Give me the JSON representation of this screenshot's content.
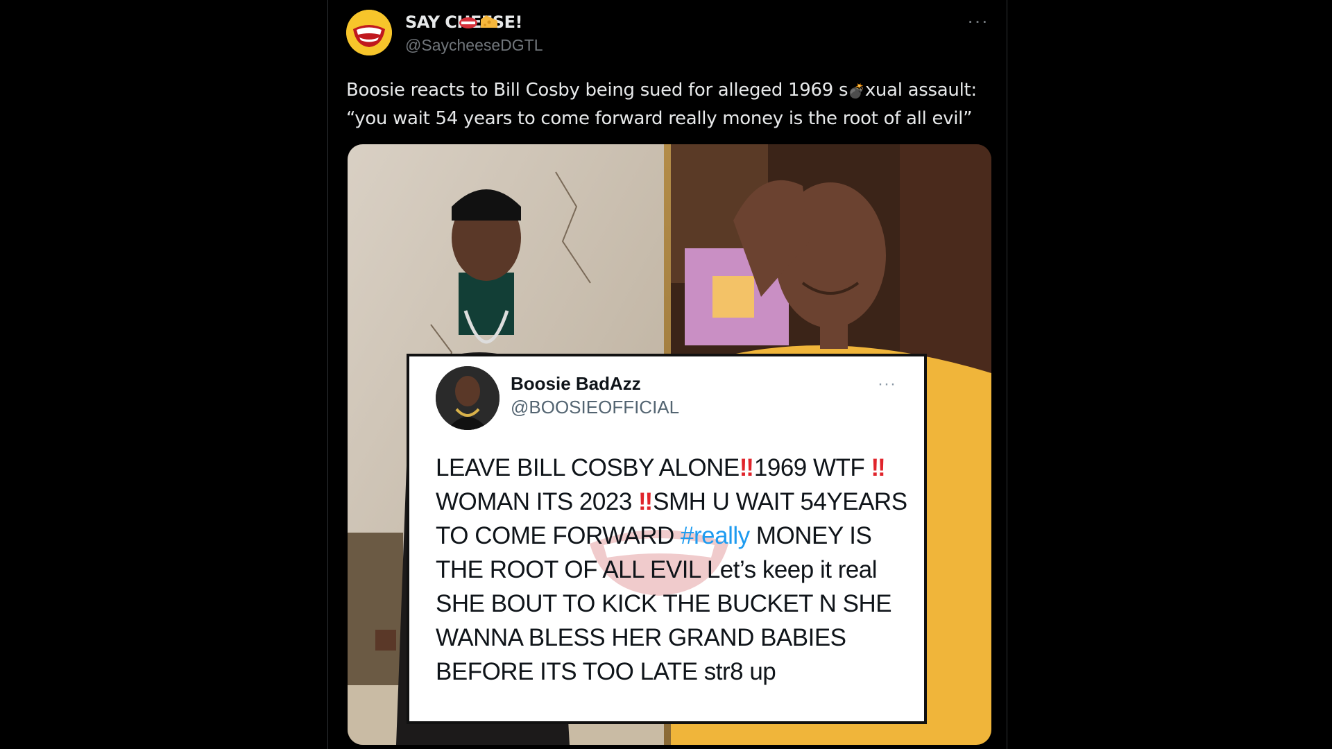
{
  "tweet": {
    "display_name": "SAY CHEESE!",
    "name_emojis": [
      "lips-icon",
      "cheese-icon"
    ],
    "handle": "@SaycheeseDGTL",
    "more_label": "···",
    "text_line1": "Boosie reacts to Bill Cosby being sued for alleged 1969 s",
    "text_censor": "💣",
    "text_line1_end": "xual assault:",
    "text_line2": "“you wait 54 years to come forward really money is the root of all evil”"
  },
  "embedded": {
    "display_name": "Boosie BadAzz",
    "handle": "@BOOSIEOFFICIAL",
    "more_label": "···",
    "bang": "‼",
    "t1": "LEAVE BILL COSBY ALONE",
    "t2": "1969 WTF ",
    "t3": "WOMAN ITS 2023 ",
    "t4": "SMH U WAIT 54YEARS TO COME FORWARD ",
    "hashtag": "#really",
    "t5": " MONEY IS THE ROOT OF ALL EVIL    Let’s keep it real SHE BOUT TO KICK THE BUCKET N SHE WANNA BLESS HER GRAND BABIES BEFORE ITS TOO LATE str8 up"
  },
  "colors": {
    "background": "#000000",
    "text_primary": "#e7e9ea",
    "text_secondary": "#71767b",
    "hashtag": "#1d9bf0",
    "emoji_red": "#e0242b"
  }
}
